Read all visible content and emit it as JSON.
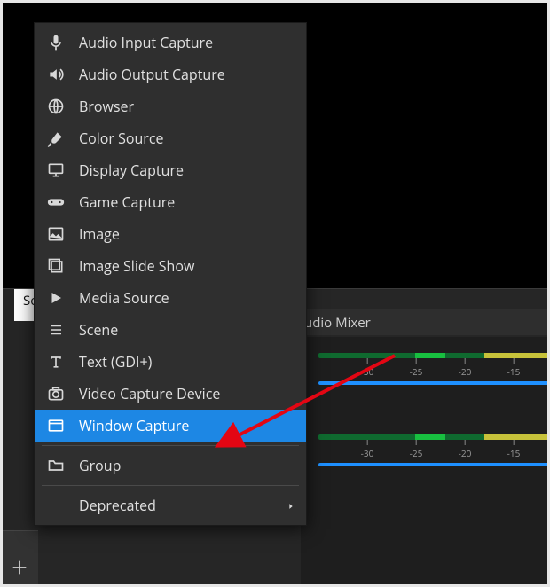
{
  "dock": {
    "left_tab_partial": "So",
    "audio_mixer_title_partial": "udio Mixer"
  },
  "audio_meter": {
    "ticks": [
      "-30",
      "-25",
      "-20",
      "-15"
    ]
  },
  "menu": {
    "items": [
      {
        "id": "audio-input-capture",
        "label": "Audio Input Capture",
        "icon": "microphone-icon"
      },
      {
        "id": "audio-output-capture",
        "label": "Audio Output Capture",
        "icon": "speaker-icon"
      },
      {
        "id": "browser",
        "label": "Browser",
        "icon": "globe-icon"
      },
      {
        "id": "color-source",
        "label": "Color Source",
        "icon": "brush-icon"
      },
      {
        "id": "display-capture",
        "label": "Display Capture",
        "icon": "monitor-icon"
      },
      {
        "id": "game-capture",
        "label": "Game Capture",
        "icon": "gamepad-icon"
      },
      {
        "id": "image",
        "label": "Image",
        "icon": "image-icon"
      },
      {
        "id": "image-slide-show",
        "label": "Image Slide Show",
        "icon": "slideshow-icon"
      },
      {
        "id": "media-source",
        "label": "Media Source",
        "icon": "play-icon"
      },
      {
        "id": "scene",
        "label": "Scene",
        "icon": "list-icon"
      },
      {
        "id": "text-gdi",
        "label": "Text (GDI+)",
        "icon": "text-icon"
      },
      {
        "id": "video-capture-device",
        "label": "Video Capture Device",
        "icon": "camera-icon"
      },
      {
        "id": "window-capture",
        "label": "Window Capture",
        "icon": "window-icon",
        "highlight": true
      }
    ],
    "group_label": "Group",
    "deprecated_label": "Deprecated"
  }
}
